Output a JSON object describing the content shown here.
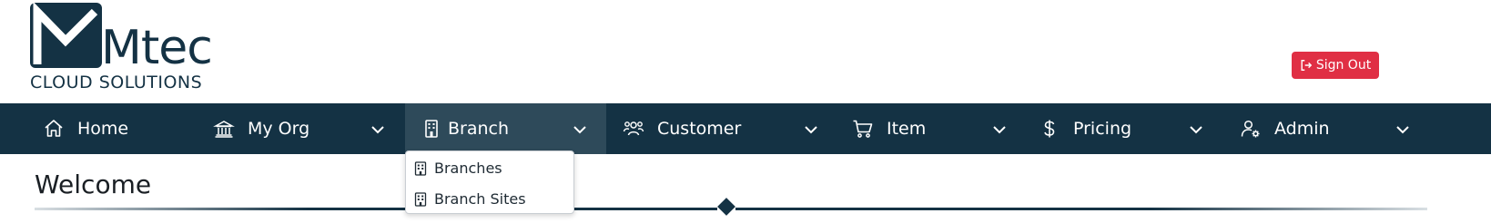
{
  "brand": {
    "name": "Mtec",
    "tagline": "CLOUD SOLUTIONS",
    "primary_color": "#143244",
    "danger_color": "#e02f44"
  },
  "header": {
    "signout_label": "Sign Out",
    "signout_icon": "sign-out-icon"
  },
  "nav": {
    "items": [
      {
        "label": "Home",
        "icon": "home-icon",
        "has_dropdown": false,
        "active": false
      },
      {
        "label": "My Org",
        "icon": "bank-icon",
        "has_dropdown": true,
        "active": false
      },
      {
        "label": "Branch",
        "icon": "building-icon",
        "has_dropdown": true,
        "active": true
      },
      {
        "label": "Customer",
        "icon": "users-icon",
        "has_dropdown": true,
        "active": false
      },
      {
        "label": "Item",
        "icon": "cart-icon",
        "has_dropdown": true,
        "active": false
      },
      {
        "label": "Pricing",
        "icon": "dollar-icon",
        "has_dropdown": true,
        "active": false
      },
      {
        "label": "Admin",
        "icon": "user-gear-icon",
        "has_dropdown": true,
        "active": false
      }
    ]
  },
  "branch_menu": {
    "items": [
      {
        "label": "Branches",
        "icon": "building-icon"
      },
      {
        "label": "Branch Sites",
        "icon": "building-icon"
      }
    ]
  },
  "page": {
    "title": "Welcome"
  }
}
